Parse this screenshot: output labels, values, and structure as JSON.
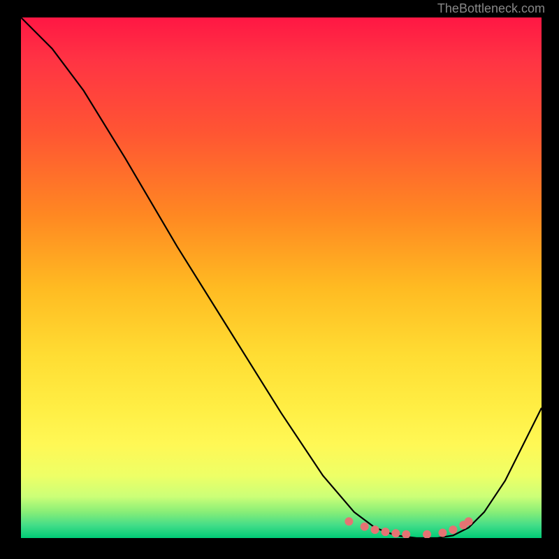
{
  "attribution": "TheBottleneck.com",
  "chart_data": {
    "type": "line",
    "title": "",
    "xlabel": "",
    "ylabel": "",
    "xlim": [
      0,
      100
    ],
    "ylim": [
      0,
      100
    ],
    "series": [
      {
        "name": "bottleneck-curve",
        "x": [
          0,
          6,
          12,
          20,
          30,
          40,
          50,
          58,
          64,
          68,
          72,
          76,
          80,
          83,
          86,
          89,
          93,
          100
        ],
        "values": [
          100,
          94,
          86,
          73,
          56,
          40,
          24,
          12,
          5,
          2,
          0.5,
          0,
          0,
          0.5,
          2,
          5,
          11,
          25
        ]
      }
    ],
    "optimal_points": {
      "name": "optimal-range-dots",
      "x": [
        63,
        66,
        68,
        70,
        72,
        74,
        78,
        81,
        83,
        85,
        86
      ],
      "values": [
        3.2,
        2.2,
        1.6,
        1.2,
        0.9,
        0.7,
        0.7,
        1.0,
        1.6,
        2.5,
        3.2
      ]
    },
    "colors": {
      "curve": "#000000",
      "dots": "#e57373",
      "gradient_top": "#ff1744",
      "gradient_mid": "#ffdd33",
      "gradient_bottom": "#00cc77"
    }
  }
}
